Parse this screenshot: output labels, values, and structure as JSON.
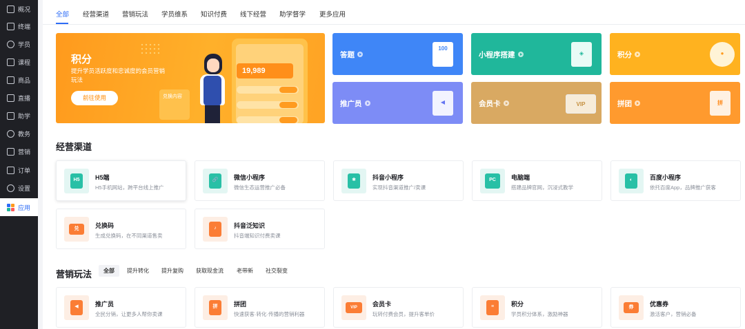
{
  "sidebar": {
    "items": [
      {
        "label": "概况"
      },
      {
        "label": "终端"
      },
      {
        "label": "学员"
      },
      {
        "label": "课程"
      },
      {
        "label": "商品"
      },
      {
        "label": "直播"
      },
      {
        "label": "助学"
      },
      {
        "label": "教务"
      },
      {
        "label": "营销"
      },
      {
        "label": "订单"
      },
      {
        "label": "设置"
      },
      {
        "label": "应用"
      }
    ],
    "active_color": "#2d6cf6"
  },
  "tabs": [
    {
      "label": "全部"
    },
    {
      "label": "经营渠道"
    },
    {
      "label": "营销玩法"
    },
    {
      "label": "学员维系"
    },
    {
      "label": "知识付费"
    },
    {
      "label": "线下经营"
    },
    {
      "label": "助学督学"
    },
    {
      "label": "更多应用"
    }
  ],
  "banner": {
    "title": "积分",
    "subtitle": "提升学员活跃度和忠诚度的会员营销玩法",
    "button": "前往使用",
    "points_value": "19,989",
    "exchange_label": "兑换内容"
  },
  "tiles": [
    {
      "label": "答题",
      "color": "#3f86f7",
      "art_text": "100"
    },
    {
      "label": "小程序搭建",
      "color": "#20b79b",
      "art_text": ""
    },
    {
      "label": "积分",
      "color": "#ffb21f",
      "art_text": ""
    },
    {
      "label": "推广员",
      "color": "#7d8cf6",
      "art_text": ""
    },
    {
      "label": "会员卡",
      "color": "#d9a962",
      "art_text": "VIP"
    },
    {
      "label": "拼团",
      "color": "#ff9a2e",
      "art_text": "拼"
    }
  ],
  "channels": {
    "title": "经营渠道",
    "items": [
      {
        "title": "H5端",
        "desc": "H5手机网站，跨平台线上推广",
        "icon": "H5"
      },
      {
        "title": "微信小程序",
        "desc": "微信生态运营推广必备",
        "icon": "🔗"
      },
      {
        "title": "抖音小程序",
        "desc": "实现抖音渠道推广/卖课",
        "icon": "✱"
      },
      {
        "title": "电脑端",
        "desc": "搭建品牌官网，沉浸式教学",
        "icon": "PC"
      },
      {
        "title": "百度小程序",
        "desc": "依托百度App，品牌推广获客",
        "icon": "◐"
      },
      {
        "title": "兑换码",
        "desc": "生成兑换码，在不同渠道售卖",
        "icon": "兑"
      },
      {
        "title": "抖音泛知识",
        "desc": "抖音端知识付费卖课",
        "icon": "♪"
      }
    ]
  },
  "marketing": {
    "title": "营销玩法",
    "filters": [
      {
        "label": "全部"
      },
      {
        "label": "提升转化"
      },
      {
        "label": "提升复购"
      },
      {
        "label": "获取现金流"
      },
      {
        "label": "老带新"
      },
      {
        "label": "社交裂变"
      }
    ],
    "items": [
      {
        "title": "推广员",
        "desc": "全民分销，让更多人帮你卖课",
        "icon": "◀"
      },
      {
        "title": "拼团",
        "desc": "快速获客·转化·传播的营销利器",
        "icon": "拼"
      },
      {
        "title": "会员卡",
        "desc": "玩转付费会员，提升客单价",
        "icon": "VIP"
      },
      {
        "title": "积分",
        "desc": "学员积分体系，激励神器",
        "icon": "≡"
      },
      {
        "title": "优惠券",
        "desc": "激活客户，营销必备",
        "icon": "券"
      }
    ]
  }
}
